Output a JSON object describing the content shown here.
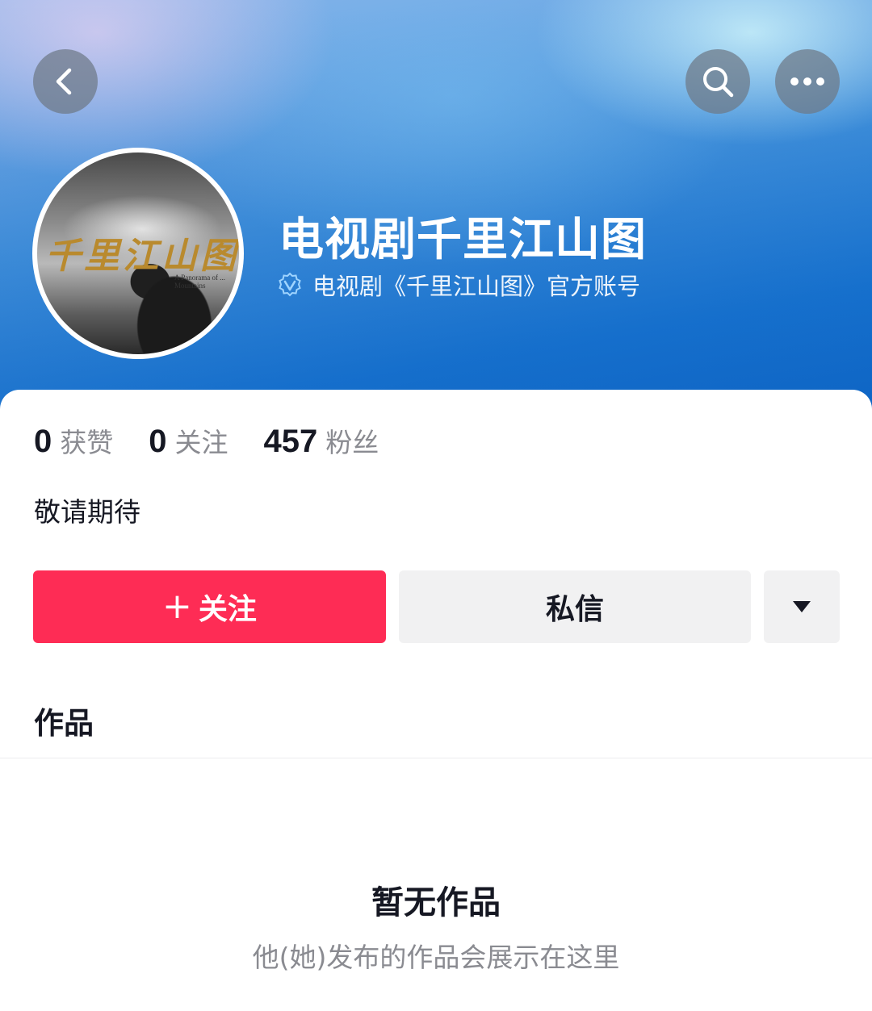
{
  "header": {
    "back_icon": "chevron-left-icon",
    "search_icon": "search-icon",
    "more_icon": "ellipsis-icon",
    "gradient_colors": [
      "#8fb6ea",
      "#3f8fda",
      "#1773cf"
    ]
  },
  "profile": {
    "name": "电视剧千里江山图",
    "verification_text": "电视剧《千里江山图》官方账号",
    "verified_icon": "verified-badge-icon",
    "avatar_poster_title": "千里江山图",
    "avatar_poster_subtitle": "A Panorama of ... Mountains"
  },
  "stats": [
    {
      "value": "0",
      "label": "获赞"
    },
    {
      "value": "0",
      "label": "关注"
    },
    {
      "value": "457",
      "label": "粉丝"
    }
  ],
  "bio": "敬请期待",
  "actions": {
    "follow_label": "关注",
    "follow_plus": "+",
    "message_label": "私信",
    "more_icon": "triangle-down-icon",
    "follow_color": "#fe2c55"
  },
  "tabs": {
    "works_label": "作品"
  },
  "empty_state": {
    "title": "暂无作品",
    "subtitle": "他(她)发布的作品会展示在这里"
  }
}
